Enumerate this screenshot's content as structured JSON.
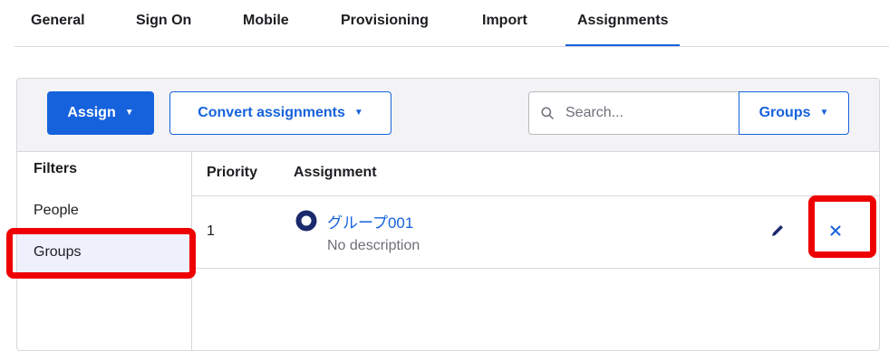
{
  "tabs": [
    {
      "label": "General",
      "active": false
    },
    {
      "label": "Sign On",
      "active": false
    },
    {
      "label": "Mobile",
      "active": false
    },
    {
      "label": "Provisioning",
      "active": false
    },
    {
      "label": "Import",
      "active": false
    },
    {
      "label": "Assignments",
      "active": true
    }
  ],
  "toolbar": {
    "assign_label": "Assign",
    "convert_label": "Convert assignments",
    "search_placeholder": "Search...",
    "search_value": "",
    "groups_select_label": "Groups",
    "caret": "▼"
  },
  "filters": {
    "title": "Filters",
    "items": [
      {
        "label": "People",
        "selected": false
      },
      {
        "label": "Groups",
        "selected": true
      }
    ]
  },
  "table": {
    "headers": {
      "priority": "Priority",
      "assignment": "Assignment"
    },
    "rows": [
      {
        "priority": "1",
        "name": "グループ001",
        "description": "No description"
      }
    ]
  },
  "icons": {
    "search": "search-icon",
    "group": "group-icon",
    "edit": "pencil-icon",
    "remove": "close-icon"
  },
  "colors": {
    "accent": "#1662dd",
    "group_icon": "#1a2a6c",
    "highlight": "#ee0000",
    "selected_filter_bg": "#eef0fc"
  }
}
